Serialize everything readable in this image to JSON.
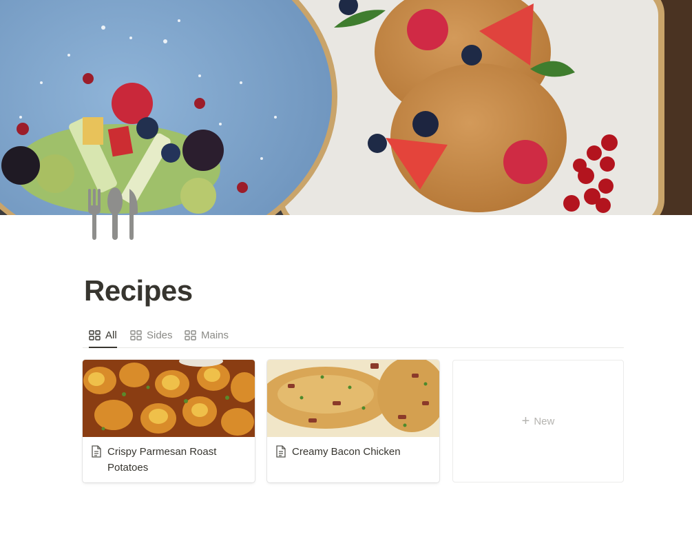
{
  "page": {
    "title": "Recipes",
    "icon": "fork-knife-icon",
    "cover": "breakfast-plates-photo"
  },
  "tabs": [
    {
      "label": "All",
      "icon": "gallery-grid-icon",
      "active": true
    },
    {
      "label": "Sides",
      "icon": "gallery-grid-icon",
      "active": false
    },
    {
      "label": "Mains",
      "icon": "gallery-grid-icon",
      "active": false
    }
  ],
  "cards": [
    {
      "title": "Crispy Parmesan Roast Potatoes",
      "icon": "page-icon",
      "cover": "roast-potatoes-photo"
    },
    {
      "title": "Creamy Bacon Chicken",
      "icon": "page-icon",
      "cover": "bacon-chicken-photo"
    }
  ],
  "new_card": {
    "label": "New",
    "icon": "plus-icon"
  },
  "colors": {
    "text": "#37352f",
    "muted": "#8a8a86",
    "new_label": "#b5b4b0",
    "border": "#e6e6e4",
    "icon_gray": "#8e8e8c"
  }
}
